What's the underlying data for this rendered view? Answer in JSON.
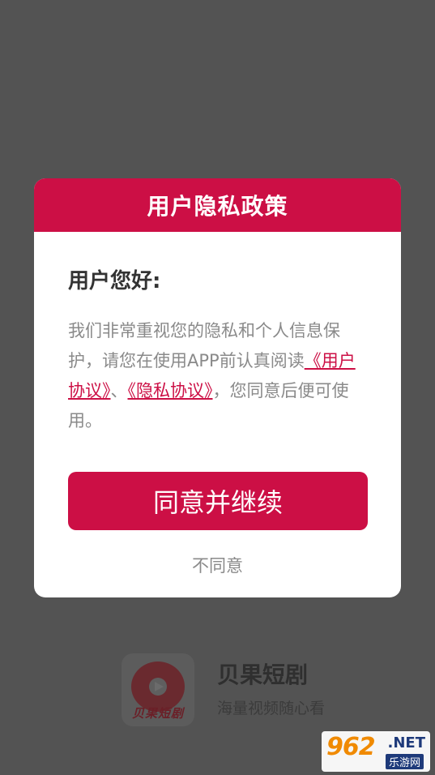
{
  "dialog": {
    "title": "用户隐私政策",
    "greeting": "用户您好:",
    "text_before": "我们非常重视您的隐私和个人信息保护，请您在使用APP前认真阅读",
    "link_user_agreement": "《用户协议》",
    "separator": "、",
    "link_privacy_agreement": "《隐私协议》",
    "text_after": "，您同意后便可使用。",
    "agree_label": "同意并继续",
    "disagree_label": "不同意"
  },
  "brand": {
    "logo_text": "贝果短剧",
    "name": "贝果短剧",
    "slogan": "海量视频随心看"
  },
  "watermark": {
    "main": "962",
    "net": ".NET",
    "sub": "乐游网"
  },
  "colors": {
    "accent": "#cc0f45",
    "overlay": "#535353",
    "text_gray": "#8a8a8a"
  }
}
